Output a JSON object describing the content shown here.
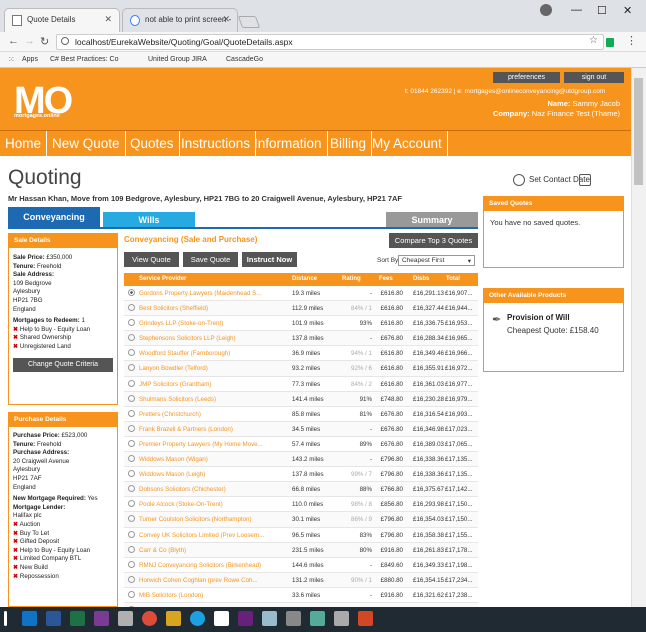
{
  "browser": {
    "tabs": [
      {
        "label": "Quote Details"
      },
      {
        "label": "not able to print screen -"
      }
    ],
    "url": "localhost/EurekaWebsite/Quoting/Goal/QuoteDetails.aspx",
    "bookmarks": [
      "Apps",
      "C# Best Practices: Co",
      "United Group JIRA",
      "CascadeGo"
    ]
  },
  "header": {
    "logo": "MO",
    "logo_sub": "mortgages.online",
    "preferences": "preferences",
    "signout": "sign out",
    "contact": "t: 01844 262392  |  e: mortgages@onlineconveyancing@utdgroup.com",
    "name_label": "Name:",
    "name": "Sammy Jacob",
    "company_label": "Company:",
    "company": "Naz Finance Test (Thame)"
  },
  "nav": [
    "Home",
    "New Quote",
    "Quotes",
    "Instructions",
    "Information",
    "Billing",
    "My Account"
  ],
  "page": {
    "title": "Quoting",
    "subtitle": "Mr Hassan Khan, Move from 109 Bedgrove, Aylesbury, HP21 7BG to 20 Craigwell Avenue, Aylesbury, HP21 7AF",
    "tabs": {
      "conveyancing": "Conveyancing",
      "wills": "Wills",
      "summary": "Summary"
    },
    "set_contact_date": "Set Contact Date"
  },
  "sale": {
    "header": "Sale Details",
    "price_label": "Sale Price:",
    "price": "£350,000",
    "tenure_label": "Tenure:",
    "tenure": "Freehold",
    "address_label": "Sale Address:",
    "address": [
      "109 Bedgrove",
      "Aylesbury",
      "HP21 7BG",
      "England"
    ],
    "redeem_label": "Mortgages to Redeem:",
    "redeem": "1",
    "flags": [
      "Help to Buy - Equity Loan",
      "Shared Ownership",
      "Unregistered Land"
    ],
    "button": "Change Quote Criteria"
  },
  "purchase": {
    "header": "Purchase Details",
    "price_label": "Purchase Price:",
    "price": "£523,000",
    "tenure_label": "Tenure:",
    "tenure": "Freehold",
    "address_label": "Purchase Address:",
    "address": [
      "20 Craigwell Avenue",
      "Aylesbury",
      "HP21 7AF",
      "England"
    ],
    "newmort_label": "New Mortgage Required:",
    "newmort": "Yes",
    "lender_label": "Mortgage Lender:",
    "lender": "Halifax plc",
    "flags": [
      "Auction",
      "Buy To Let",
      "Gifted Deposit",
      "Help to Buy - Equity Loan",
      "Limited Company BTL",
      "New Build",
      "Repossession"
    ]
  },
  "quotes": {
    "title": "Conveyancing (Sale and Purchase)",
    "compare": "Compare Top 3 Quotes",
    "view": "View Quote",
    "save": "Save Quote",
    "instruct": "Instruct Now",
    "sortby_label": "Sort By",
    "sortby": "Cheapest First",
    "columns": [
      "Service Provider",
      "Distance",
      "Rating",
      "Fees",
      "Disbs",
      "Total"
    ],
    "rows": [
      [
        "Gordons Property Lawyers (Maidenhead S...",
        "19.3 miles",
        "-",
        "£616.80",
        "£16,291.13",
        "£16,907..."
      ],
      [
        "Best Solicitors (Sheffield)",
        "112.9 miles",
        "84% / 1",
        "£616.80",
        "£16,327.44",
        "£16,944..."
      ],
      [
        "Grindeys LLP (Stoke-on-Trent)",
        "101.9 miles",
        "93%",
        "£616.80",
        "£16,336.75",
        "£16,953..."
      ],
      [
        "Stephensons Solicitors LLP (Leigh)",
        "137.8 miles",
        "-",
        "£676.80",
        "£16,288.34",
        "£16,965..."
      ],
      [
        "Woodford Stauffer (Farnborough)",
        "36.9 miles",
        "94% / 1",
        "£616.80",
        "£16,349.46",
        "£16,966..."
      ],
      [
        "Lanyon Bowdler (Telford)",
        "93.2 miles",
        "92% / 6",
        "£616.80",
        "£16,355.91",
        "£16,972..."
      ],
      [
        "JMP Solicitors (Grantham)",
        "77.3 miles",
        "84% / 2",
        "£616.80",
        "£16,361.03",
        "£16,977..."
      ],
      [
        "Shulmans Solicitors (Leeds)",
        "141.4 miles",
        "91%",
        "£748.80",
        "£16,230.28",
        "£16,979..."
      ],
      [
        "Pretlers (Christchurch)",
        "85.8 miles",
        "81%",
        "£676.80",
        "£16,316.54",
        "£16,993..."
      ],
      [
        "Frank Brazell & Partners (London)",
        "34.5 miles",
        "-",
        "£676.80",
        "£16,346.98",
        "£17,023..."
      ],
      [
        "Premier Property Lawyers (My Home Move...",
        "57.4 miles",
        "89%",
        "£676.80",
        "£16,389.03",
        "£17,065..."
      ],
      [
        "Widdows Mason (Wigan)",
        "143.2 miles",
        "-",
        "£796.80",
        "£16,338.36",
        "£17,135..."
      ],
      [
        "Widdows Mason (Leigh)",
        "137.8 miles",
        "99% / 7",
        "£796.80",
        "£16,338.36",
        "£17,135..."
      ],
      [
        "Dobsons Solicitors (Chichester)",
        "66.8 miles",
        "88%",
        "£766.80",
        "£16,375.67",
        "£17,142..."
      ],
      [
        "Poole Alcock (Stoke-On-Trent)",
        "110.0 miles",
        "98% / 8",
        "£856.80",
        "£16,293.98",
        "£17,150..."
      ],
      [
        "Turner Coulston Solicitors (Northampton)",
        "30.1 miles",
        "86% / 9",
        "£796.80",
        "£16,354.03",
        "£17,150..."
      ],
      [
        "Convey UK Solicitors Limited (Prev Loosem...",
        "96.5 miles",
        "83%",
        "£796.80",
        "£16,358.38",
        "£17,155..."
      ],
      [
        "Carr & Co (Blyth)",
        "231.5 miles",
        "80%",
        "£916.80",
        "£16,261.83",
        "£17,178..."
      ],
      [
        "RMNJ Conveyancing Solicitors (Birkenhead)",
        "144.6 miles",
        "-",
        "£849.60",
        "£16,349.33",
        "£17,198..."
      ],
      [
        "Horwich Cohen Coghlan (prev Rowe Coh...",
        "131.2 miles",
        "90% / 1",
        "£880.80",
        "£16,354.15",
        "£17,234..."
      ],
      [
        "MIB Solicitors (London)",
        "33.6 miles",
        "-",
        "£916.80",
        "£16,321.62",
        "£17,238..."
      ],
      [
        "Azmi Rana Solicitors (Manchester)",
        "133.0 miles",
        "-",
        "£916.80",
        "£16,325.28",
        "£17,242..."
      ]
    ]
  },
  "saved": {
    "header": "Saved Quotes",
    "text": "You have no saved quotes."
  },
  "other": {
    "header": "Other Available Products",
    "product": "Provision of Will",
    "price_label": "Cheapest Quote:",
    "price": "£158.40"
  }
}
